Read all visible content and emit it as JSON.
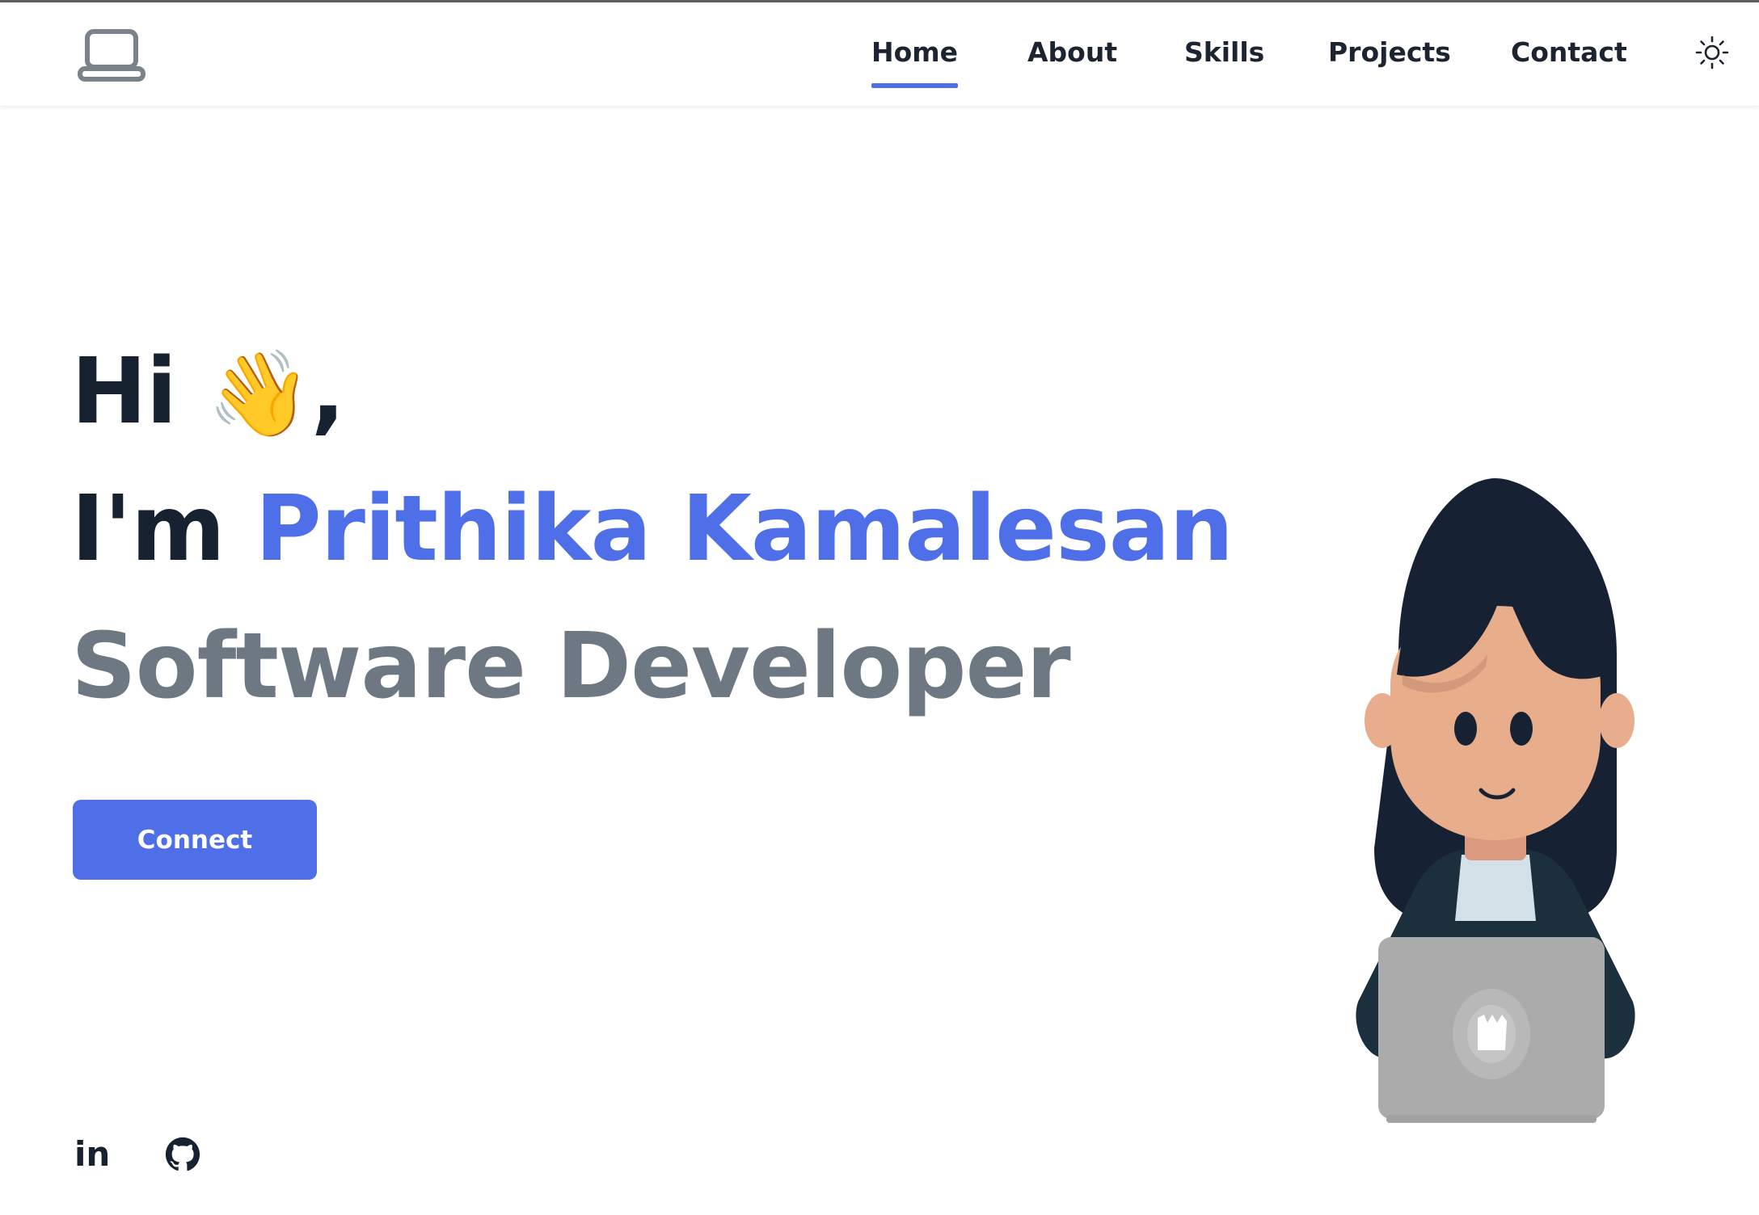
{
  "nav": {
    "logo_icon": "laptop-icon",
    "items": [
      {
        "label": "Home",
        "active": true
      },
      {
        "label": "About",
        "active": false
      },
      {
        "label": "Skills",
        "active": false
      },
      {
        "label": "Projects",
        "active": false
      },
      {
        "label": "Contact",
        "active": false
      }
    ],
    "theme_icon": "sun-icon"
  },
  "hero": {
    "greeting": "Hi",
    "wave_emoji": "👋",
    "greeting_punct": ",",
    "intro": "I'm",
    "name": "Prithika Kamalesan",
    "role": "Software Developer",
    "cta_label": "Connect"
  },
  "social": {
    "linkedin_label": "in",
    "github_icon": "github-icon"
  },
  "colors": {
    "accent": "#4f6fe8",
    "heading": "#162230",
    "subheading": "#6d7882",
    "nav_text": "#1b2430"
  }
}
